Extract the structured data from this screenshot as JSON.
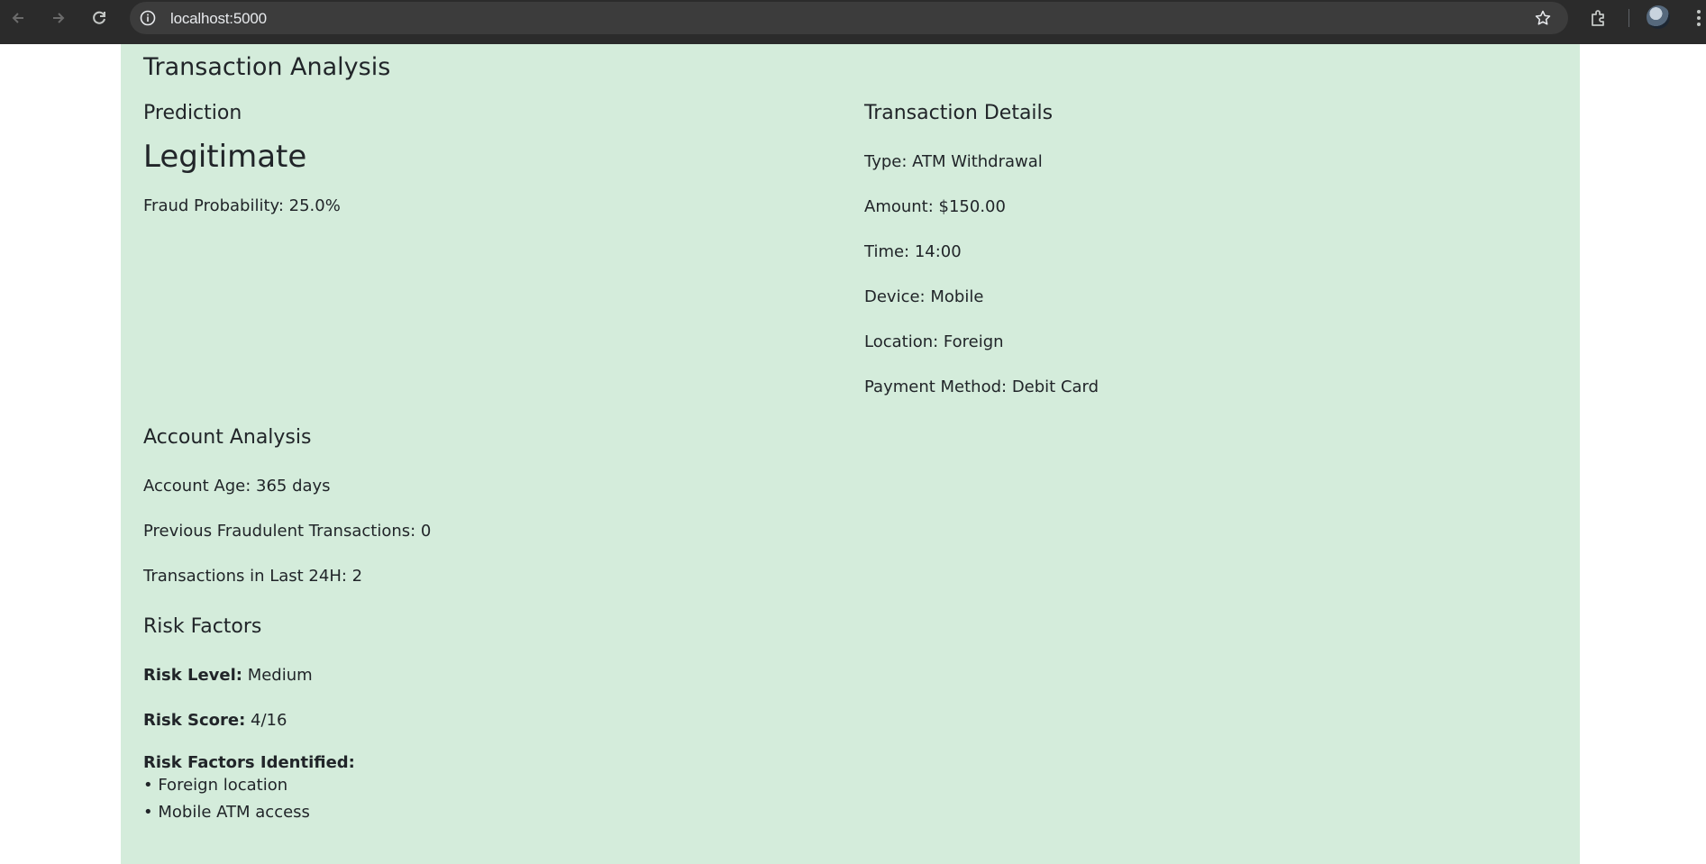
{
  "browser": {
    "url": "localhost:5000"
  },
  "page": {
    "title": "Transaction Analysis",
    "prediction": {
      "heading": "Prediction",
      "verdict": "Legitimate",
      "probability_label": "Fraud Probability: 25.0%"
    },
    "details": {
      "heading": "Transaction Details",
      "lines": [
        "Type: ATM Withdrawal",
        "Amount: $150.00",
        "Time: 14:00",
        "Device: Mobile",
        "Location: Foreign",
        "Payment Method: Debit Card"
      ]
    },
    "account": {
      "heading": "Account Analysis",
      "lines": [
        "Account Age: 365 days",
        "Previous Fraudulent Transactions: 0",
        "Transactions in Last 24H: 2"
      ]
    },
    "risk": {
      "heading": "Risk Factors",
      "level_label": "Risk Level:",
      "level_value": "Medium",
      "score_label": "Risk Score:",
      "score_value": "4/16",
      "identified_label": "Risk Factors Identified:",
      "factors": [
        "Foreign location",
        "Mobile ATM access"
      ]
    }
  },
  "colors": {
    "page_background": "#d4ecdb",
    "chrome_background": "#2b2b2b",
    "text": "#212529"
  }
}
